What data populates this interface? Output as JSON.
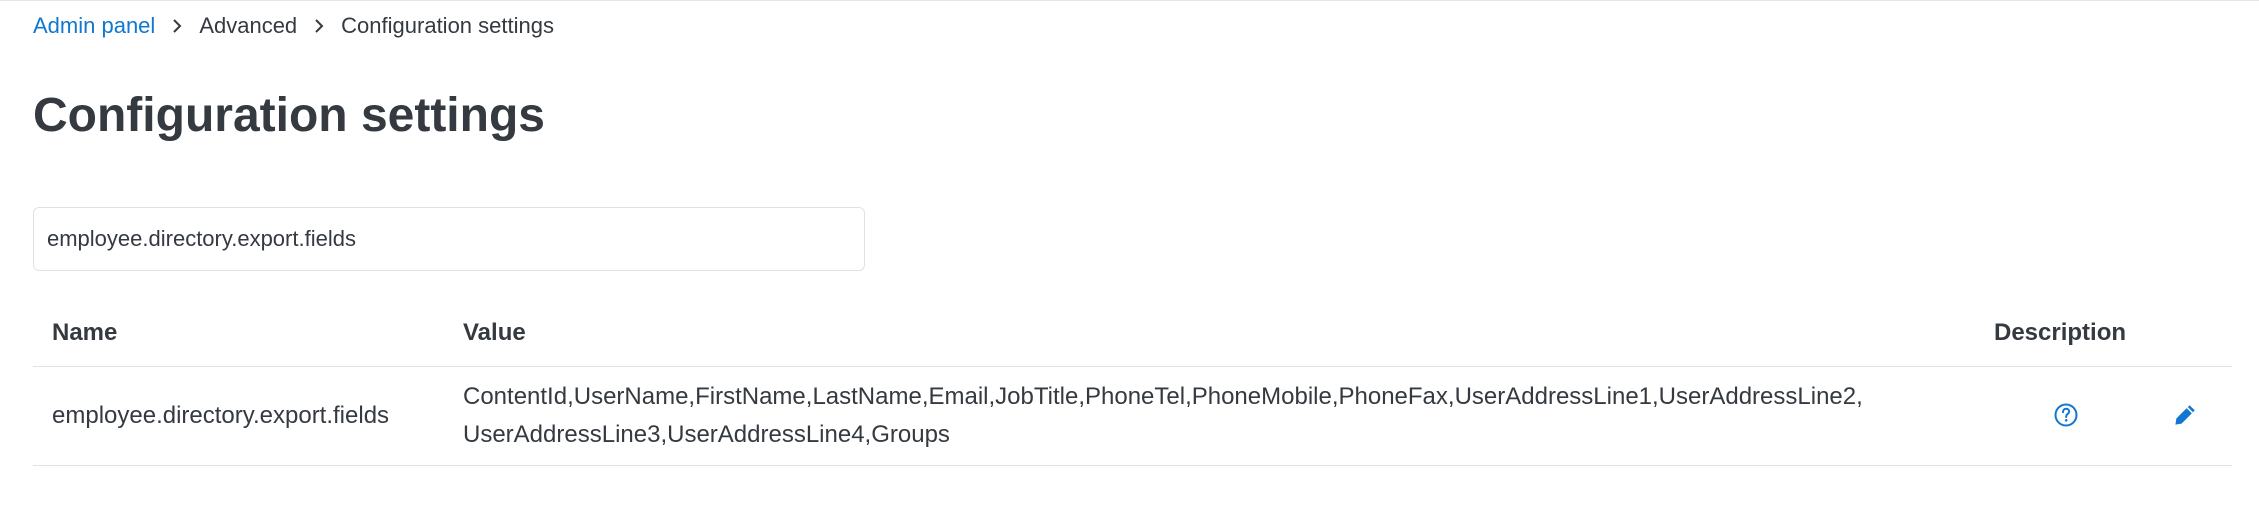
{
  "breadcrumb": {
    "items": [
      {
        "label": "Admin panel",
        "link": true
      },
      {
        "label": "Advanced",
        "link": false
      },
      {
        "label": "Configuration settings",
        "link": false
      }
    ]
  },
  "page": {
    "title": "Configuration settings"
  },
  "search": {
    "value": "employee.directory.export.fields"
  },
  "table": {
    "headers": {
      "name": "Name",
      "value": "Value",
      "description": "Description"
    },
    "rows": [
      {
        "name": "employee.directory.export.fields",
        "value_line1": "ContentId,UserName,FirstName,LastName,Email,JobTitle,PhoneTel,PhoneMobile,PhoneFax,UserAddressLine1,UserAddressLine2,",
        "value_line2": "UserAddressLine3,UserAddressLine4,Groups",
        "description_icon": "help-circle-icon",
        "edit_icon": "pencil-icon"
      }
    ]
  },
  "colors": {
    "link": "#1177d1",
    "text": "#343a40",
    "border": "#dee2e6"
  }
}
